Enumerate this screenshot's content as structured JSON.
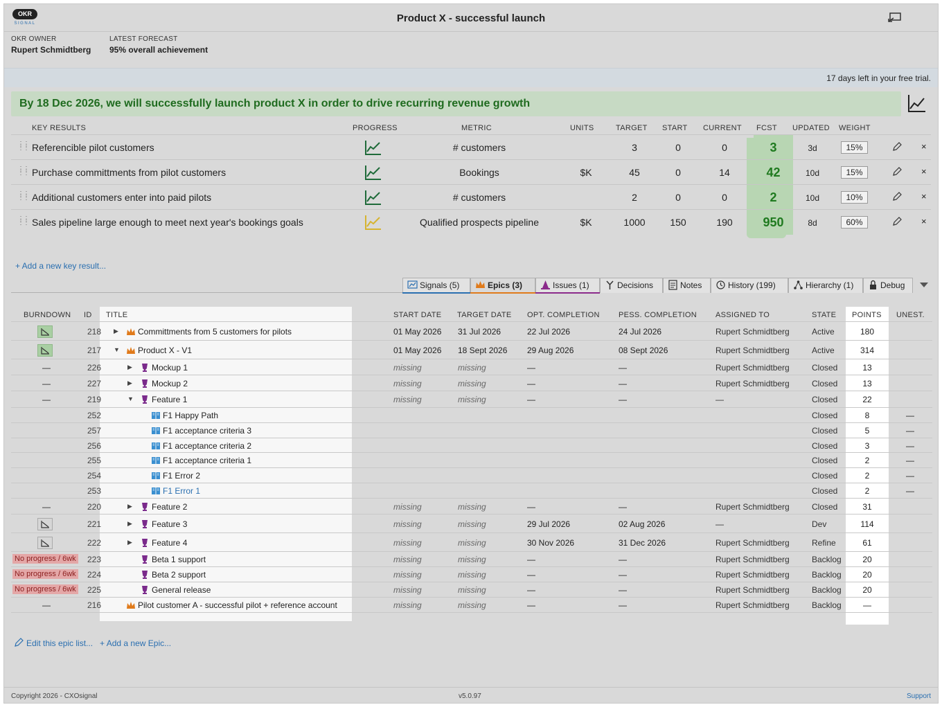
{
  "app": {
    "logo_text": "OKR",
    "logo_sub": "SIGNAL",
    "title": "Product X - successful launch"
  },
  "owner": {
    "owner_label": "OKR OWNER",
    "owner_value": "Rupert Schmidtberg",
    "forecast_label": "LATEST FORECAST",
    "forecast_value": "95% overall achievement"
  },
  "trial_text": "17 days left in your free trial.",
  "objective": "By 18 Dec 2026, we will successfully launch product X in order to drive recurring revenue growth",
  "kr_headers": {
    "key_results": "KEY RESULTS",
    "progress": "PROGRESS",
    "metric": "METRIC",
    "units": "UNITS",
    "target": "TARGET",
    "start": "START",
    "current": "CURRENT",
    "fcst": "FCST",
    "updated": "UPDATED",
    "weight": "WEIGHT"
  },
  "key_results": [
    {
      "name": "Referencible pilot customers",
      "metric": "# customers",
      "units": "",
      "target": "3",
      "start": "0",
      "current": "0",
      "fcst": "3",
      "updated": "3d",
      "weight": "15%",
      "progress_color": "#1f6b3a"
    },
    {
      "name": "Purchase committments from pilot customers",
      "metric": "Bookings",
      "units": "$K",
      "target": "45",
      "start": "0",
      "current": "14",
      "fcst": "42",
      "updated": "10d",
      "weight": "15%",
      "progress_color": "#1f6b3a"
    },
    {
      "name": "Additional customers enter into paid pilots",
      "metric": "# customers",
      "units": "",
      "target": "2",
      "start": "0",
      "current": "0",
      "fcst": "2",
      "updated": "10d",
      "weight": "10%",
      "progress_color": "#1f6b3a"
    },
    {
      "name": "Sales pipeline large enough to meet next year's bookings goals",
      "metric": "Qualified prospects pipeline",
      "units": "$K",
      "target": "1000",
      "start": "150",
      "current": "190",
      "fcst": "950",
      "updated": "8d",
      "weight": "60%",
      "progress_color": "#d6b430"
    }
  ],
  "add_kr_label": "+ Add a new key result...",
  "tabs": [
    {
      "label": "Signals (5)",
      "icon": "signals-icon"
    },
    {
      "label": "Epics (3)",
      "icon": "crown-icon"
    },
    {
      "label": "Issues (1)",
      "icon": "cone-icon"
    },
    {
      "label": "Decisions",
      "icon": "fork-icon"
    },
    {
      "label": "Notes",
      "icon": "notes-icon"
    },
    {
      "label": "History (199)",
      "icon": "history-icon"
    },
    {
      "label": "Hierarchy (1)",
      "icon": "hierarchy-icon"
    },
    {
      "label": "Debug",
      "icon": "lock-icon"
    }
  ],
  "epic_headers": {
    "burndown": "BURNDOWN",
    "id": "ID",
    "title": "TITLE",
    "start": "START DATE",
    "target": "TARGET DATE",
    "opt": "OPT. COMPLETION",
    "pess": "PESS. COMPLETION",
    "assigned": "ASSIGNED TO",
    "state": "STATE",
    "points": "POINTS",
    "unest": "UNEST."
  },
  "epics": [
    {
      "burndown": "icon",
      "id": "218",
      "toggle": "▶",
      "icon": "crown",
      "level": 0,
      "title": "Committments from 5 customers for pilots",
      "start": "01 May 2026",
      "target": "31 Jul 2026",
      "opt": "22 Jul 2026",
      "pess": "24 Jul 2026",
      "assigned": "Rupert Schmidtberg",
      "state": "Active",
      "points": "180",
      "unest": ""
    },
    {
      "burndown": "icon",
      "id": "217",
      "toggle": "▼",
      "icon": "crown",
      "level": 0,
      "title": "Product X - V1",
      "start": "01 May 2026",
      "target": "18 Sept 2026",
      "opt": "29 Aug 2026",
      "pess": "08 Sept 2026",
      "assigned": "Rupert Schmidtberg",
      "state": "Active",
      "points": "314",
      "unest": ""
    },
    {
      "burndown": "—",
      "id": "226",
      "toggle": "▶",
      "icon": "trophy",
      "level": 1,
      "title": "Mockup 1",
      "start": "missing",
      "target": "missing",
      "opt": "—",
      "pess": "—",
      "assigned": "Rupert Schmidtberg",
      "state": "Closed",
      "points": "13",
      "unest": ""
    },
    {
      "burndown": "—",
      "id": "227",
      "toggle": "▶",
      "icon": "trophy",
      "level": 1,
      "title": "Mockup 2",
      "start": "missing",
      "target": "missing",
      "opt": "—",
      "pess": "—",
      "assigned": "Rupert Schmidtberg",
      "state": "Closed",
      "points": "13",
      "unest": ""
    },
    {
      "burndown": "—",
      "id": "219",
      "toggle": "▼",
      "icon": "trophy",
      "level": 1,
      "title": "Feature 1",
      "start": "missing",
      "target": "missing",
      "opt": "—",
      "pess": "—",
      "assigned": "—",
      "state": "Closed",
      "points": "22",
      "unest": ""
    },
    {
      "burndown": "",
      "id": "252",
      "toggle": "",
      "icon": "book",
      "level": 2,
      "title": "F1 Happy Path",
      "start": "",
      "target": "",
      "opt": "",
      "pess": "",
      "assigned": "",
      "state": "Closed",
      "points": "8",
      "unest": "—"
    },
    {
      "burndown": "",
      "id": "257",
      "toggle": "",
      "icon": "book",
      "level": 2,
      "title": "F1 acceptance criteria 3",
      "start": "",
      "target": "",
      "opt": "",
      "pess": "",
      "assigned": "",
      "state": "Closed",
      "points": "5",
      "unest": "—"
    },
    {
      "burndown": "",
      "id": "256",
      "toggle": "",
      "icon": "book",
      "level": 2,
      "title": "F1 acceptance criteria 2",
      "start": "",
      "target": "",
      "opt": "",
      "pess": "",
      "assigned": "",
      "state": "Closed",
      "points": "3",
      "unest": "—"
    },
    {
      "burndown": "",
      "id": "255",
      "toggle": "",
      "icon": "book",
      "level": 2,
      "title": "F1 acceptance criteria 1",
      "start": "",
      "target": "",
      "opt": "",
      "pess": "",
      "assigned": "",
      "state": "Closed",
      "points": "2",
      "unest": "—"
    },
    {
      "burndown": "",
      "id": "254",
      "toggle": "",
      "icon": "book",
      "level": 2,
      "title": "F1 Error 2",
      "start": "",
      "target": "",
      "opt": "",
      "pess": "",
      "assigned": "",
      "state": "Closed",
      "points": "2",
      "unest": "—"
    },
    {
      "burndown": "",
      "id": "253",
      "toggle": "",
      "icon": "book",
      "level": 2,
      "title": "F1 Error 1",
      "start": "",
      "target": "",
      "opt": "",
      "pess": "",
      "assigned": "",
      "state": "Closed",
      "points": "2",
      "unest": "—",
      "link": true
    },
    {
      "burndown": "—",
      "id": "220",
      "toggle": "▶",
      "icon": "trophy",
      "level": 1,
      "title": "Feature 2",
      "start": "missing",
      "target": "missing",
      "opt": "—",
      "pess": "—",
      "assigned": "Rupert Schmidtberg",
      "state": "Closed",
      "points": "31",
      "unest": ""
    },
    {
      "burndown": "gicon",
      "id": "221",
      "toggle": "▶",
      "icon": "trophy",
      "level": 1,
      "title": "Feature 3",
      "start": "missing",
      "target": "missing",
      "opt": "29 Jul 2026",
      "pess": "02 Aug 2026",
      "assigned": "—",
      "state": "Dev",
      "points": "114",
      "unest": ""
    },
    {
      "burndown": "gicon",
      "id": "222",
      "toggle": "▶",
      "icon": "trophy",
      "level": 1,
      "title": "Feature 4",
      "start": "missing",
      "target": "missing",
      "opt": "30 Nov 2026",
      "pess": "31 Dec 2026",
      "assigned": "Rupert Schmidtberg",
      "state": "Refine",
      "points": "61",
      "unest": ""
    },
    {
      "burndown": "No progress / 6wk",
      "id": "223",
      "toggle": "",
      "icon": "trophy",
      "level": 1,
      "title": "Beta 1 support",
      "start": "missing",
      "target": "missing",
      "opt": "—",
      "pess": "—",
      "assigned": "Rupert Schmidtberg",
      "state": "Backlog",
      "points": "20",
      "unest": ""
    },
    {
      "burndown": "No progress / 6wk",
      "id": "224",
      "toggle": "",
      "icon": "trophy",
      "level": 1,
      "title": "Beta 2 support",
      "start": "missing",
      "target": "missing",
      "opt": "—",
      "pess": "—",
      "assigned": "Rupert Schmidtberg",
      "state": "Backlog",
      "points": "20",
      "unest": ""
    },
    {
      "burndown": "No progress / 6wk",
      "id": "225",
      "toggle": "",
      "icon": "trophy",
      "level": 1,
      "title": "General release",
      "start": "missing",
      "target": "missing",
      "opt": "—",
      "pess": "—",
      "assigned": "Rupert Schmidtberg",
      "state": "Backlog",
      "points": "20",
      "unest": ""
    },
    {
      "burndown": "—",
      "id": "216",
      "toggle": "",
      "icon": "crown",
      "level": 0,
      "title": "Pilot customer A - successful pilot + reference account",
      "start": "missing",
      "target": "missing",
      "opt": "—",
      "pess": "—",
      "assigned": "Rupert Schmidtberg",
      "state": "Backlog",
      "points": "—",
      "unest": ""
    }
  ],
  "edit_epic_label": "Edit this epic list...",
  "add_epic_label": "+ Add a new Epic...",
  "footer": {
    "copyright": "Copyright 2026 - CXOsignal",
    "version": "v5.0.97",
    "support": "Support"
  }
}
